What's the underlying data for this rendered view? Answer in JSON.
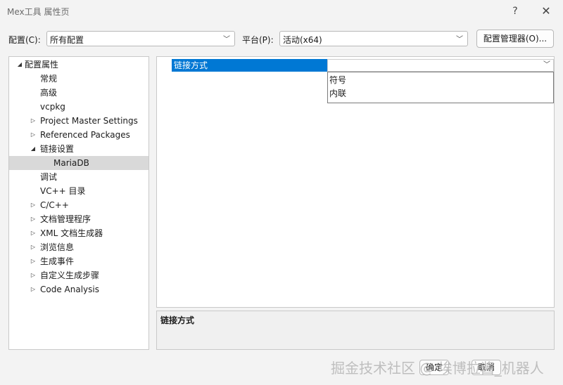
{
  "window": {
    "title": "Mex工具 属性页",
    "help_label": "?",
    "close_label": "✕"
  },
  "toolbar": {
    "config_label": "配置(C):",
    "config_value": "所有配置",
    "platform_label": "平台(P):",
    "platform_value": "活动(x64)",
    "config_manager_label": "配置管理器(O)..."
  },
  "tree": {
    "items": [
      {
        "label": "配置属性",
        "arrow": "◢"
      },
      {
        "label": "常规"
      },
      {
        "label": "高级"
      },
      {
        "label": "vcpkg"
      },
      {
        "label": "Project Master Settings",
        "arrow": "▷"
      },
      {
        "label": "Referenced Packages",
        "arrow": "▷"
      },
      {
        "label": "链接设置",
        "arrow": "◢"
      },
      {
        "label": "MariaDB",
        "selected": true
      },
      {
        "label": "调试"
      },
      {
        "label": "VC++ 目录"
      },
      {
        "label": "C/C++",
        "arrow": "▷"
      },
      {
        "label": "文档管理程序",
        "arrow": "▷"
      },
      {
        "label": "XML 文档生成器",
        "arrow": "▷"
      },
      {
        "label": "浏览信息",
        "arrow": "▷"
      },
      {
        "label": "生成事件",
        "arrow": "▷"
      },
      {
        "label": "自定义生成步骤",
        "arrow": "▷"
      },
      {
        "label": "Code Analysis",
        "arrow": "▷"
      }
    ]
  },
  "grid": {
    "property_name": "链接方式",
    "options": [
      "符号",
      "内联"
    ]
  },
  "description": {
    "title": "链接方式"
  },
  "footer": {
    "ok_label": "确定",
    "cancel_label": "取消"
  },
  "watermark": "掘金技术社区 @ 埃博拉酱_机器人",
  "icons": {
    "dropdown": "chevron-down-icon",
    "expanded": "expanded-triangle-icon",
    "collapsed": "collapsed-triangle-icon"
  }
}
